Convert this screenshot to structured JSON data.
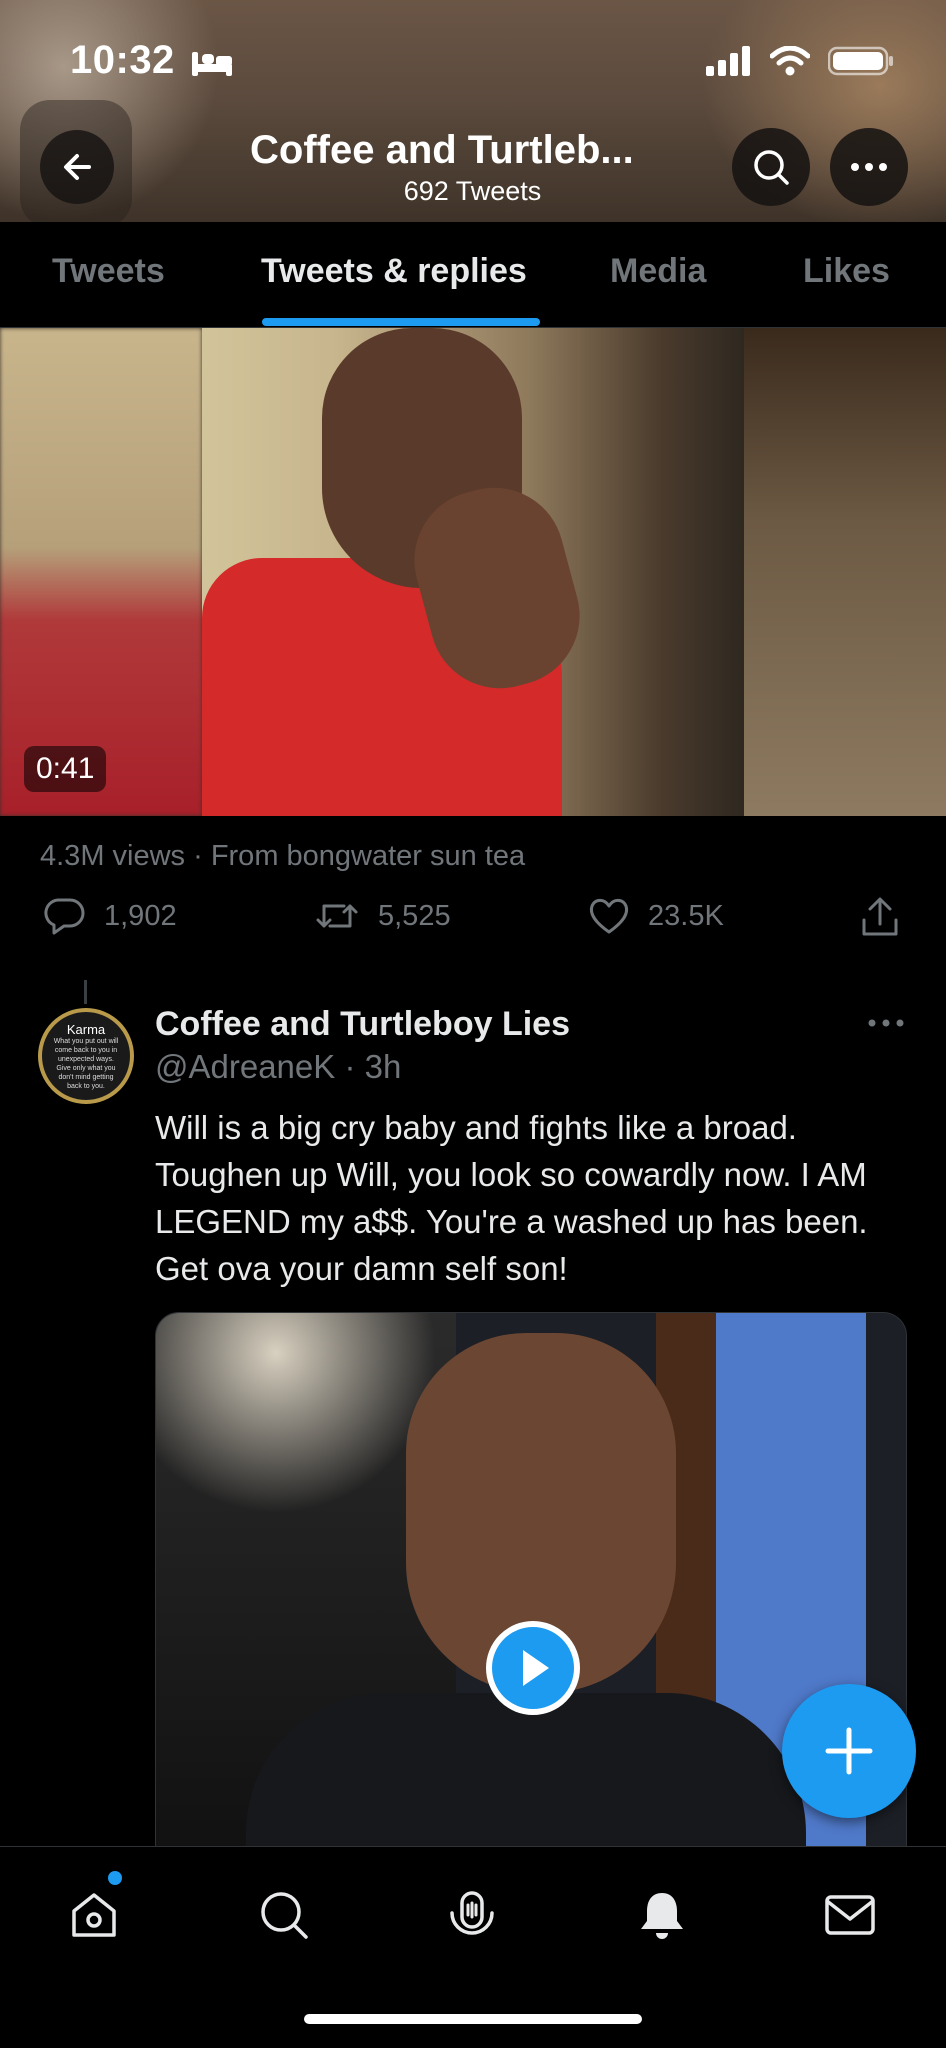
{
  "status_bar": {
    "time": "10:32"
  },
  "header": {
    "title": "Coffee and Turtleb...",
    "subtitle": "692 Tweets"
  },
  "tabs": [
    {
      "label": "Tweets",
      "active": false
    },
    {
      "label": "Tweets & replies",
      "active": true
    },
    {
      "label": "Media",
      "active": false
    },
    {
      "label": "Likes",
      "active": false
    }
  ],
  "video": {
    "duration": "0:41",
    "views_line": "4.3M views · From bongwater sun tea"
  },
  "actions": {
    "replies": "1,902",
    "retweets": "5,525",
    "likes": "23.5K"
  },
  "tweet": {
    "name": "Coffee and Turtleboy Lies",
    "handle_time": "@AdreaneK · 3h",
    "body": "Will is a big cry baby and fights like a broad.  Toughen up Will, you look so cowardly now.  I AM LEGEND my a$$.  You're a washed up has been.  Get ova your damn self son!",
    "avatar_title": "Karma",
    "avatar_text": "What you put out will come back to you in unexpected ways. Give only what you don't mind getting back to you."
  },
  "colors": {
    "accent": "#1d9bf0",
    "secondary_text": "#71767b",
    "background": "#000000"
  },
  "icons": [
    "back-arrow-icon",
    "search-icon",
    "more-icon",
    "reply-icon",
    "retweet-icon",
    "like-icon",
    "share-icon",
    "play-icon",
    "compose-plus-icon",
    "home-icon",
    "explore-icon",
    "spaces-icon",
    "notifications-icon",
    "messages-icon"
  ]
}
